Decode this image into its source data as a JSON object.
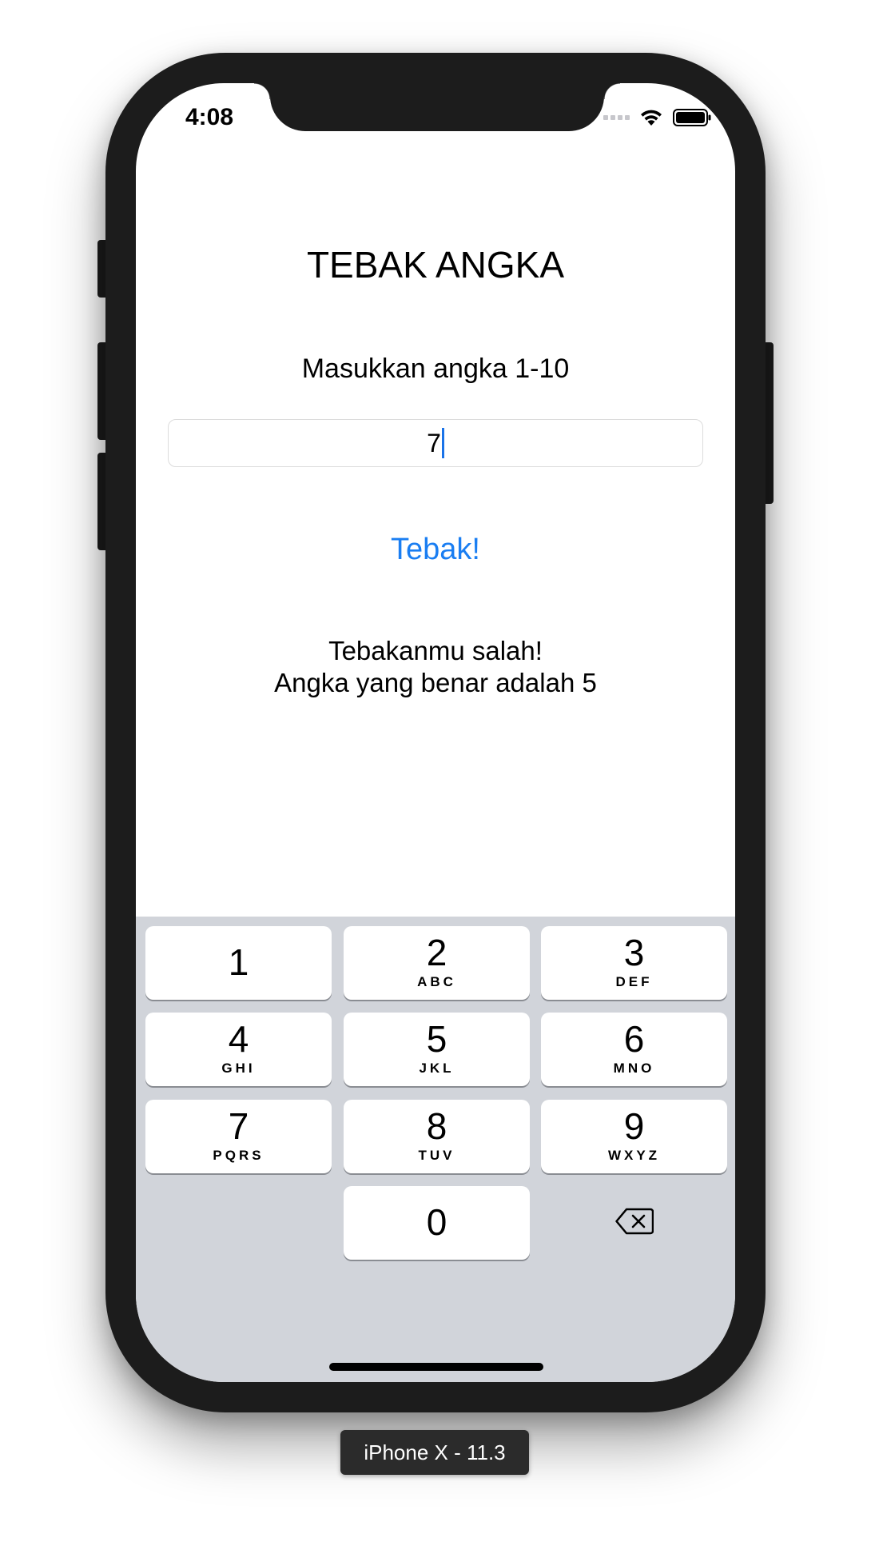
{
  "status_bar": {
    "time": "4:08"
  },
  "app": {
    "title": "TEBAK ANGKA",
    "prompt": "Masukkan angka 1-10",
    "input_value": "7",
    "guess_button_label": "Tebak!",
    "result_line1": "Tebakanmu salah!",
    "result_line2": "Angka yang benar adalah 5"
  },
  "keyboard": {
    "keys": [
      {
        "digit": "1",
        "letters": ""
      },
      {
        "digit": "2",
        "letters": "ABC"
      },
      {
        "digit": "3",
        "letters": "DEF"
      },
      {
        "digit": "4",
        "letters": "GHI"
      },
      {
        "digit": "5",
        "letters": "JKL"
      },
      {
        "digit": "6",
        "letters": "MNO"
      },
      {
        "digit": "7",
        "letters": "PQRS"
      },
      {
        "digit": "8",
        "letters": "TUV"
      },
      {
        "digit": "9",
        "letters": "WXYZ"
      },
      {
        "digit": "0",
        "letters": ""
      }
    ],
    "backspace_icon": "delete-backward-icon"
  },
  "device_label": "iPhone X - 11.3",
  "colors": {
    "accent": "#1a7ef2",
    "keyboard_bg": "#d1d4da",
    "frame": "#1c1c1c"
  }
}
